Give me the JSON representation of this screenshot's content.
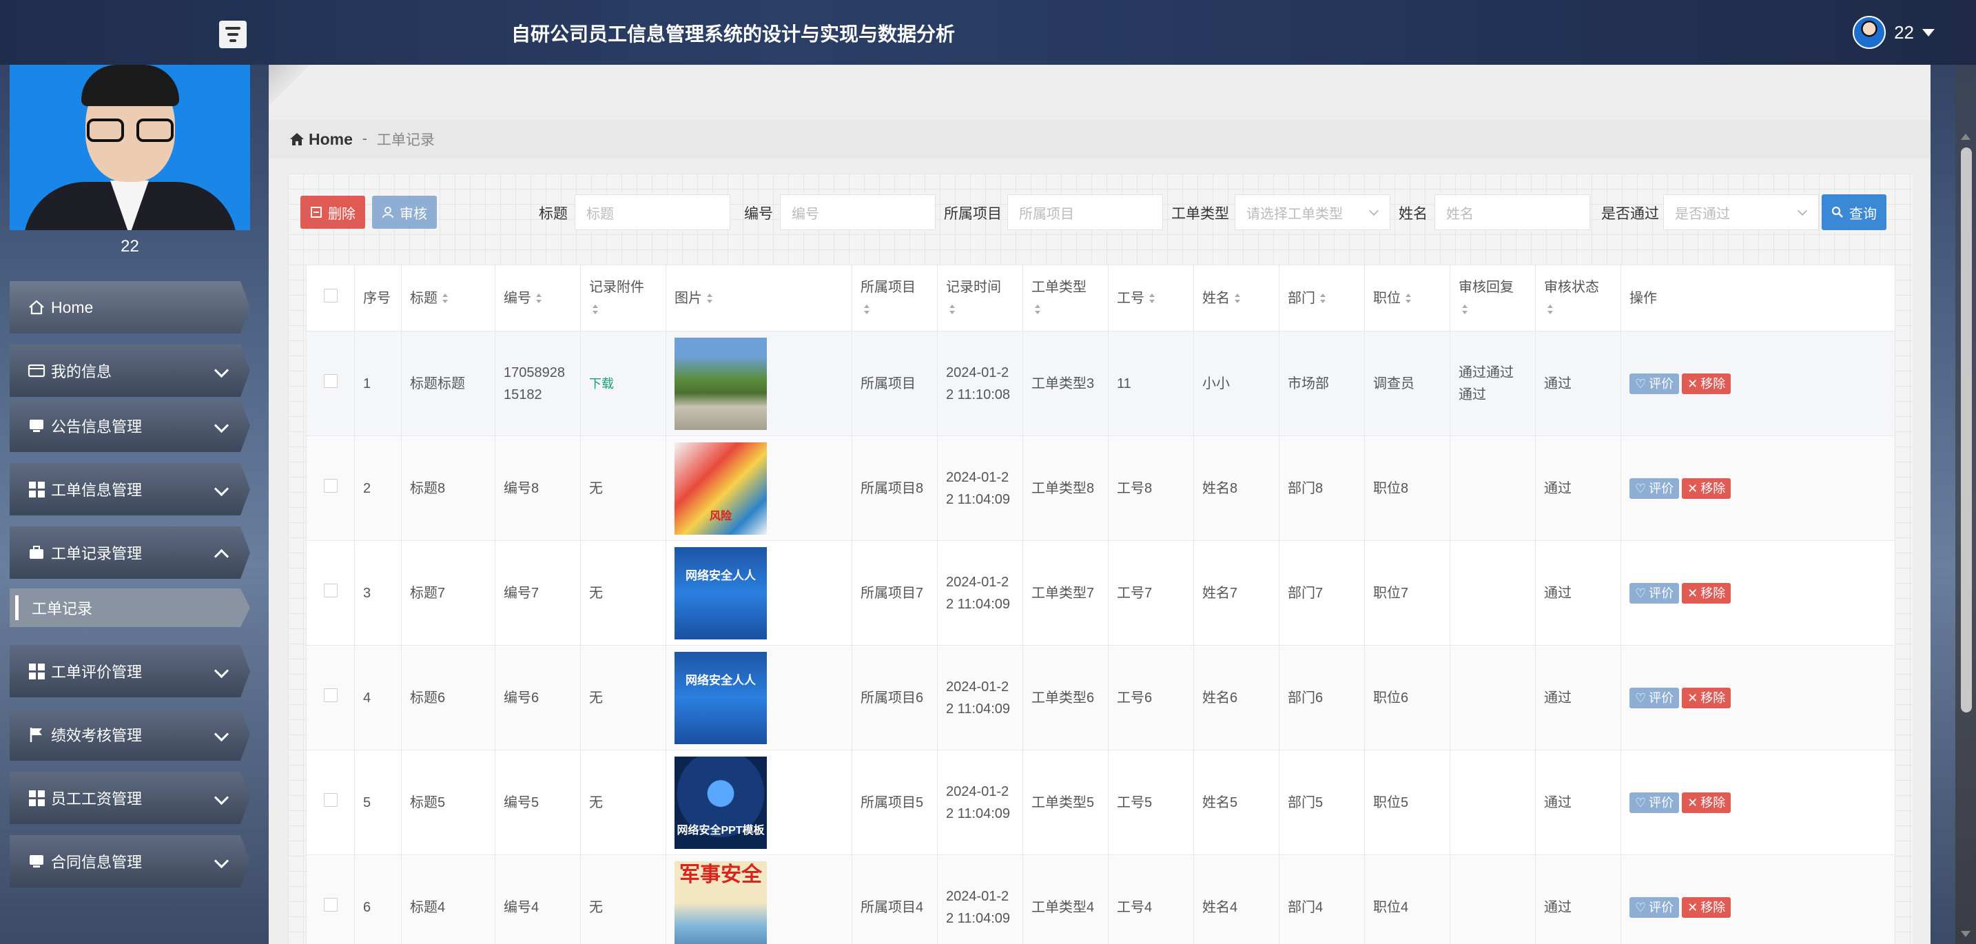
{
  "header": {
    "title": "自研公司员工信息管理系统的设计与实现与数据分析",
    "username": "22"
  },
  "sidebar": {
    "username": "22",
    "items": [
      {
        "label": "Home"
      },
      {
        "label": "我的信息"
      },
      {
        "label": "公告信息管理"
      },
      {
        "label": "工单信息管理"
      },
      {
        "label": "工单记录管理"
      },
      {
        "label": "工单评价管理"
      },
      {
        "label": "绩效考核管理"
      },
      {
        "label": "员工工资管理"
      },
      {
        "label": "合同信息管理"
      }
    ],
    "active_sub": "工单记录"
  },
  "breadcrumb": {
    "home": "Home",
    "separator": "-",
    "current": "工单记录"
  },
  "toolbar": {
    "delete_label": "删除",
    "audit_label": "审核",
    "query_label": "查询",
    "filters": [
      {
        "label": "标题",
        "placeholder": "标题"
      },
      {
        "label": "编号",
        "placeholder": "编号"
      },
      {
        "label": "所属项目",
        "placeholder": "所属项目"
      },
      {
        "label": "工单类型",
        "placeholder": "请选择工单类型"
      },
      {
        "label": "姓名",
        "placeholder": "姓名"
      },
      {
        "label": "是否通过",
        "placeholder": "是否通过"
      }
    ]
  },
  "table": {
    "headers": [
      "序号",
      "标题",
      "编号",
      "记录附件",
      "图片",
      "所属项目",
      "记录时间",
      "工单类型",
      "工号",
      "姓名",
      "部门",
      "职位",
      "审核回复",
      "审核状态",
      "操作"
    ],
    "action_eval": "评价",
    "action_remove": "移除",
    "rows": [
      {
        "no": "1",
        "title": "标题标题",
        "code": "1705892815182",
        "attachment": "下载",
        "project": "所属项目",
        "time": "2024-01-22 11:10:08",
        "type": "工单类型3",
        "empno": "11",
        "name": "小小",
        "dept": "市场部",
        "position": "调查员",
        "reply": "通过通过通过",
        "status": "通过"
      },
      {
        "no": "2",
        "title": "标题8",
        "code": "编号8",
        "attachment": "无",
        "project": "所属项目8",
        "time": "2024-01-22 11:04:09",
        "type": "工单类型8",
        "empno": "工号8",
        "name": "姓名8",
        "dept": "部门8",
        "position": "职位8",
        "reply": "",
        "status": "通过",
        "img_text": "风险"
      },
      {
        "no": "3",
        "title": "标题7",
        "code": "编号7",
        "attachment": "无",
        "project": "所属项目7",
        "time": "2024-01-22 11:04:09",
        "type": "工单类型7",
        "empno": "工号7",
        "name": "姓名7",
        "dept": "部门7",
        "position": "职位7",
        "reply": "",
        "status": "通过",
        "img_text": "网络安全人人"
      },
      {
        "no": "4",
        "title": "标题6",
        "code": "编号6",
        "attachment": "无",
        "project": "所属项目6",
        "time": "2024-01-22 11:04:09",
        "type": "工单类型6",
        "empno": "工号6",
        "name": "姓名6",
        "dept": "部门6",
        "position": "职位6",
        "reply": "",
        "status": "通过",
        "img_text": "网络安全人人"
      },
      {
        "no": "5",
        "title": "标题5",
        "code": "编号5",
        "attachment": "无",
        "project": "所属项目5",
        "time": "2024-01-22 11:04:09",
        "type": "工单类型5",
        "empno": "工号5",
        "name": "姓名5",
        "dept": "部门5",
        "position": "职位5",
        "reply": "",
        "status": "通过",
        "img_text": "网络安全PPT模板"
      },
      {
        "no": "6",
        "title": "标题4",
        "code": "编号4",
        "attachment": "无",
        "project": "所属项目4",
        "time": "2024-01-22 11:04:09",
        "type": "工单类型4",
        "empno": "工号4",
        "name": "姓名4",
        "dept": "部门4",
        "position": "职位4",
        "reply": "",
        "status": "通过",
        "img_text": "军事安全"
      }
    ]
  }
}
